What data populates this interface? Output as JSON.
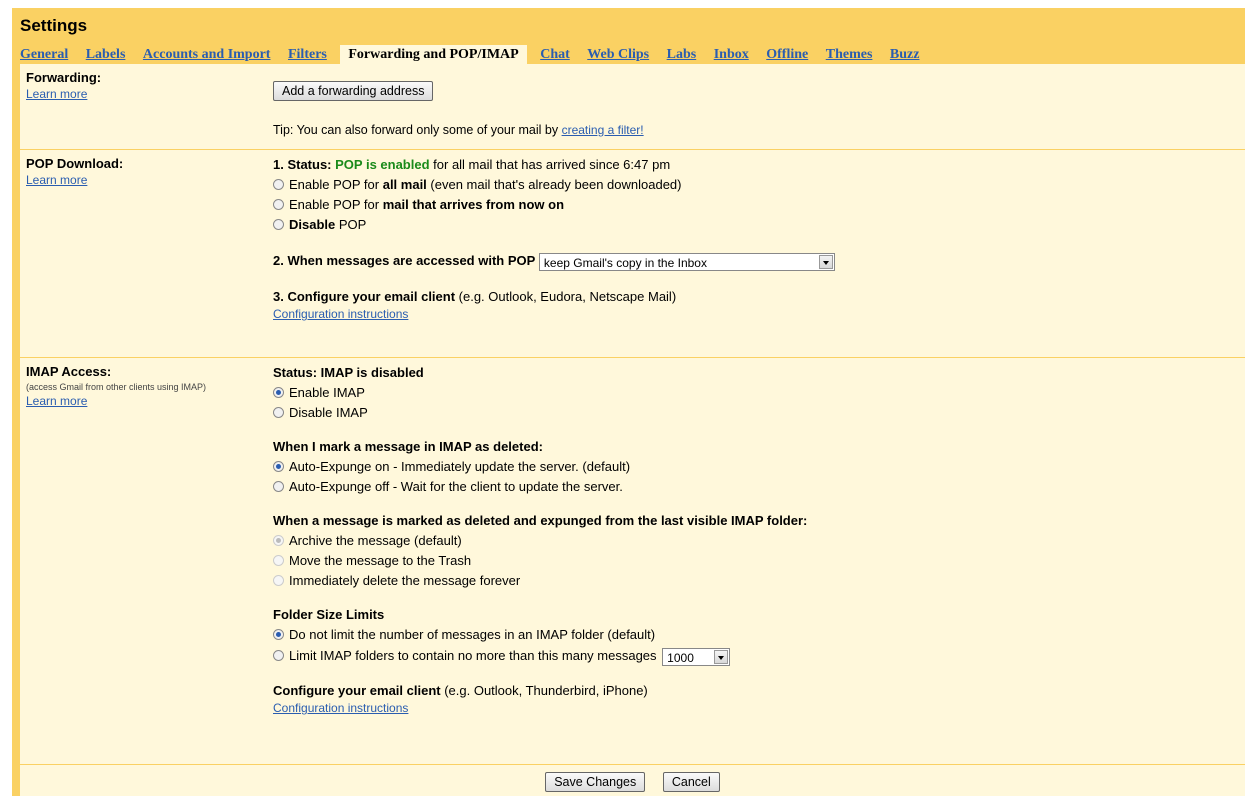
{
  "header": {
    "title": "Settings"
  },
  "tabs": [
    "General",
    "Labels",
    "Accounts and Import",
    "Filters",
    "Forwarding and POP/IMAP",
    "Chat",
    "Web Clips",
    "Labs",
    "Inbox",
    "Offline",
    "Themes",
    "Buzz"
  ],
  "active_tab": "Forwarding and POP/IMAP",
  "forwarding": {
    "label": "Forwarding:",
    "learn_more": "Learn more",
    "add_button": "Add a forwarding address",
    "tip_prefix": "Tip: You can also forward only some of your mail by ",
    "tip_link": "creating a filter!"
  },
  "pop": {
    "label": "POP Download:",
    "learn_more": "Learn more",
    "status_prefix": "1. Status: ",
    "status_value": "POP is enabled",
    "status_suffix": " for all mail that has arrived since 6:47 pm",
    "opt1_a": "Enable POP for ",
    "opt1_b": "all mail",
    "opt1_c": " (even mail that's already been downloaded)",
    "opt2_a": "Enable POP for ",
    "opt2_b": "mail that arrives from now on",
    "opt3_a": "Disable",
    "opt3_b": " POP",
    "access_label": "2. When messages are accessed with POP",
    "access_value": "keep Gmail's copy in the Inbox",
    "configure_bold": "3. Configure your email client",
    "configure_rest": " (e.g. Outlook, Eudora, Netscape Mail)",
    "config_link": "Configuration instructions"
  },
  "imap": {
    "label": "IMAP Access:",
    "sublabel": "(access Gmail from other clients using IMAP)",
    "learn_more": "Learn more",
    "status": "Status: IMAP is disabled",
    "enable": "Enable IMAP",
    "disable": "Disable IMAP",
    "deleted_heading": "When I mark a message in IMAP as deleted:",
    "expunge_on": "Auto-Expunge on - Immediately update the server. (default)",
    "expunge_off": "Auto-Expunge off - Wait for the client to update the server.",
    "expunged_heading": "When a message is marked as deleted and expunged from the last visible IMAP folder:",
    "archive": "Archive the message (default)",
    "trash": "Move the message to the Trash",
    "delete_forever": "Immediately delete the message forever",
    "folder_heading": "Folder Size Limits",
    "no_limit": "Do not limit the number of messages in an IMAP folder (default)",
    "limit": "Limit IMAP folders to contain no more than this many messages",
    "limit_value": "1000",
    "configure_bold": "Configure your email client",
    "configure_rest": " (e.g. Outlook, Thunderbird, iPhone)",
    "config_link": "Configuration instructions"
  },
  "footer": {
    "save": "Save Changes",
    "cancel": "Cancel"
  },
  "colors": {
    "tab_bar": "#fad163",
    "panel": "#fff8db",
    "link": "#2a5db0",
    "enabled": "#1a8a1a"
  }
}
